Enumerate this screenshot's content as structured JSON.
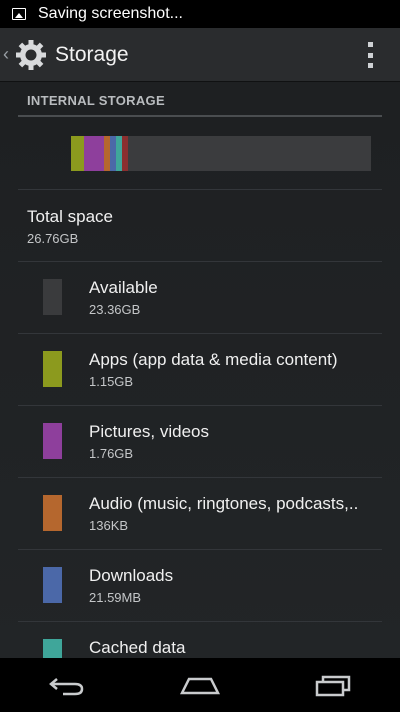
{
  "status_bar": {
    "text": "Saving screenshot..."
  },
  "action_bar": {
    "title": "Storage"
  },
  "section": {
    "header": "INTERNAL STORAGE"
  },
  "usage_bar": {
    "segments": [
      {
        "name": "apps",
        "color": "#8c9a1e",
        "fraction": 0.043
      },
      {
        "name": "pictures",
        "color": "#8e3f9c",
        "fraction": 0.066
      },
      {
        "name": "audio",
        "color": "#b5672e",
        "fraction": 0.02
      },
      {
        "name": "downloads",
        "color": "#4b68a8",
        "fraction": 0.02
      },
      {
        "name": "cached",
        "color": "#3fa69a",
        "fraction": 0.02
      },
      {
        "name": "misc",
        "color": "#8a2f2f",
        "fraction": 0.02
      }
    ],
    "track_color": "#3b3c3e"
  },
  "total": {
    "title": "Total space",
    "value": "26.76GB"
  },
  "items": [
    {
      "label": "Available",
      "value": "23.36GB",
      "color": "#3a3b3d"
    },
    {
      "label": "Apps (app data & media content)",
      "value": "1.15GB",
      "color": "#8c9a1e"
    },
    {
      "label": "Pictures, videos",
      "value": "1.76GB",
      "color": "#8e3f9c"
    },
    {
      "label": "Audio (music, ringtones, podcasts,..",
      "value": "136KB",
      "color": "#b5672e"
    },
    {
      "label": "Downloads",
      "value": "21.59MB",
      "color": "#4b68a8"
    },
    {
      "label": "Cached data",
      "value": "",
      "color": "#3fa69a"
    }
  ]
}
